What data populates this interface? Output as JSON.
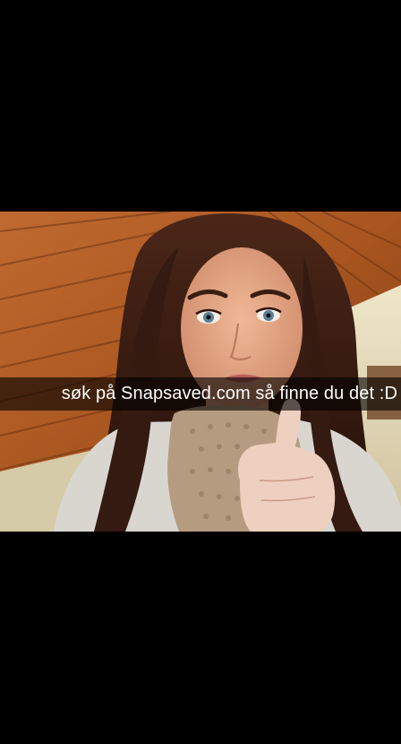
{
  "snap": {
    "caption": "søk på Snapsaved.com så finne du det :D",
    "photo_subject": "selfie-photo"
  },
  "colors": {
    "background": "#000000",
    "caption_bar": "rgba(0,0,0,0.62)",
    "caption_text": "#ffffff",
    "wood": "#b5602a",
    "wall": "#e6dcc0",
    "hair": "#3b1f14",
    "skin": "#e2a585",
    "sweater": "#d9d6d0",
    "scarf": "#b59c80"
  }
}
